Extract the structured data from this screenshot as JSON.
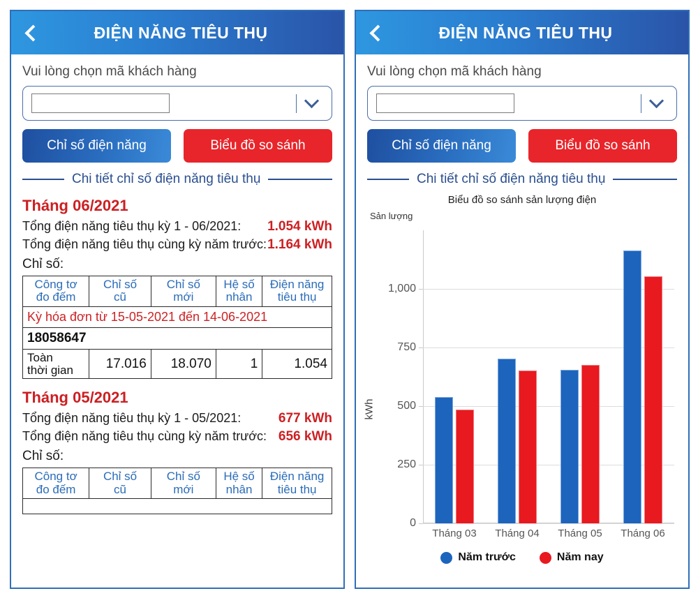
{
  "app": {
    "title": "ĐIỆN NĂNG TIÊU THỤ",
    "back_icon": "chevron-left-icon"
  },
  "form": {
    "hint": "Vui lòng chọn mã khách hàng",
    "customer_code_value": "",
    "customer_code_placeholder": "",
    "dropdown_icon": "chevron-down-icon"
  },
  "buttons": {
    "index_label": "Chỉ số điện năng",
    "chart_label": "Biểu đồ so sánh",
    "blue_color": "#2a6ec0",
    "red_color": "#e8252b"
  },
  "divider": {
    "text": "Chi tiết chỉ số điện năng tiêu thụ"
  },
  "table_headers": {
    "meter": "Công tơ\nđo đếm",
    "old": "Chỉ số\ncũ",
    "new": "Chỉ số\nmới",
    "factor": "Hệ số\nnhân",
    "consumption": "Điện năng\ntiêu thụ",
    "meter_l1": "Công tơ",
    "meter_l2": "đo đếm",
    "old_l1": "Chỉ số",
    "old_l2": "cũ",
    "new_l1": "Chỉ số",
    "new_l2": "mới",
    "factor_l1": "Hệ số",
    "factor_l2": "nhân",
    "cons_l1": "Điện năng",
    "cons_l2": "tiêu thụ"
  },
  "months": [
    {
      "title": "Tháng 06/2021",
      "total_label": "Tổng điện năng tiêu thụ kỳ 1 - 06/2021:",
      "total_value": "1.054 kWh",
      "prev_label": "Tổng điện năng tiêu thụ cùng kỳ năm trước:",
      "prev_value": "1.164 kWh",
      "index_label": "Chỉ số:",
      "billing_cycle": "Kỳ hóa đơn từ 15-05-2021 đến 14-06-2021",
      "meter_id": "18058647",
      "row": {
        "label_l1": "Toàn",
        "label_l2": "thời gian",
        "old": "17.016",
        "new": "18.070",
        "factor": "1",
        "consumption": "1.054"
      }
    },
    {
      "title": "Tháng 05/2021",
      "total_label": "Tổng điện năng tiêu thụ kỳ 1 - 05/2021:",
      "total_value": "677 kWh",
      "prev_label": "Tổng điện năng tiêu thụ cùng kỳ năm trước:",
      "prev_value": "656 kWh",
      "index_label": "Chỉ số:"
    }
  ],
  "chart_data": {
    "type": "bar",
    "title": "Biểu đồ so sánh sản lượng điện",
    "ylabel_top": "Sản lượng",
    "ylabel": "kWh",
    "xlabel": "",
    "categories": [
      "Tháng 03",
      "Tháng 04",
      "Tháng 05",
      "Tháng 06"
    ],
    "series": [
      {
        "name": "Năm trước",
        "color": "#1d64bd",
        "values": [
          538,
          703,
          656,
          1164
        ]
      },
      {
        "name": "Năm nay",
        "color": "#e8191f",
        "values": [
          485,
          653,
          677,
          1054
        ]
      }
    ],
    "yticks": [
      0,
      250,
      500,
      750,
      1000
    ],
    "ytick_labels": [
      "0",
      "250",
      "500",
      "750",
      "1,000"
    ],
    "ylim": [
      0,
      1250
    ],
    "grid": true,
    "legend_position": "bottom"
  }
}
